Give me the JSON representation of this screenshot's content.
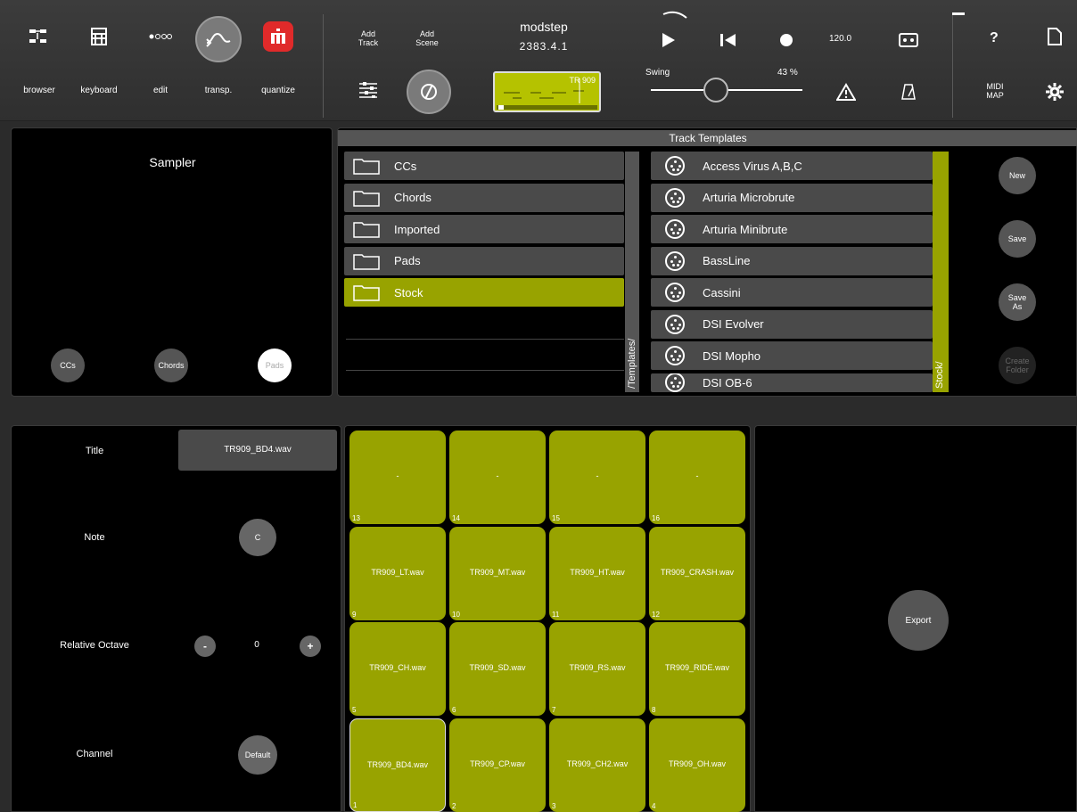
{
  "toolbar": {
    "nav": [
      {
        "label": "browser",
        "icon": "browser-icon"
      },
      {
        "label": "keyboard",
        "icon": "keyboard-icon"
      },
      {
        "label": "edit",
        "icon": "dots-icon"
      },
      {
        "label": "transp.",
        "icon": "transpose-icon"
      },
      {
        "label": "quantize",
        "icon": "quantize-icon"
      }
    ],
    "add_track": "Add\nTrack",
    "add_scene": "Add\nScene",
    "app_title": "modstep",
    "position": "2383.4.1",
    "tempo": "120.0",
    "swing_label": "Swing",
    "swing_value": "43 %",
    "swing_fraction": 0.43,
    "clip_name": "TR 909",
    "help": "?",
    "midi_map": "MIDI\nMAP"
  },
  "sampler": {
    "title": "Sampler",
    "modes": [
      "CCs",
      "Chords",
      "Pads"
    ],
    "active_mode": "Pads"
  },
  "templates": {
    "header": "Track Templates",
    "folders": [
      "CCs",
      "Chords",
      "Imported",
      "Pads",
      "Stock"
    ],
    "selected_folder": "Stock",
    "folder_path": "/Templates/",
    "items": [
      "Access Virus A,B,C",
      "Arturia Microbrute",
      "Arturia Minibrute",
      "BassLine",
      "Cassini",
      "DSI Evolver",
      "DSI Mopho",
      "DSI OB-6"
    ],
    "items_path": "Stock/",
    "actions": [
      "New",
      "Save",
      "Save\nAs",
      "Create\nFolder"
    ]
  },
  "pad_editor": {
    "title_label": "Title",
    "title_value": "TR909_BD4.wav",
    "note_label": "Note",
    "note_value": "C",
    "octave_label": "Relative Octave",
    "octave_minus": "-",
    "octave_value": "0",
    "octave_plus": "+",
    "channel_label": "Channel",
    "channel_value": "Default"
  },
  "pads": [
    {
      "num": "13",
      "label": "-"
    },
    {
      "num": "14",
      "label": "-"
    },
    {
      "num": "15",
      "label": "-"
    },
    {
      "num": "16",
      "label": "-"
    },
    {
      "num": "9",
      "label": "TR909_LT.wav"
    },
    {
      "num": "10",
      "label": "TR909_MT.wav"
    },
    {
      "num": "11",
      "label": "TR909_HT.wav"
    },
    {
      "num": "12",
      "label": "TR909_CRASH.wav"
    },
    {
      "num": "5",
      "label": "TR909_CH.wav"
    },
    {
      "num": "6",
      "label": "TR909_SD.wav"
    },
    {
      "num": "7",
      "label": "TR909_RS.wav"
    },
    {
      "num": "8",
      "label": "TR909_RIDE.wav"
    },
    {
      "num": "1",
      "label": "TR909_BD4.wav"
    },
    {
      "num": "2",
      "label": "TR909_CP.wav"
    },
    {
      "num": "3",
      "label": "TR909_CH2.wav"
    },
    {
      "num": "4",
      "label": "TR909_OH.wav"
    }
  ],
  "selected_pad": "1",
  "export_label": "Export",
  "colors": {
    "accent": "#98a300",
    "panel": "#000000",
    "row": "#4a4a4a"
  }
}
